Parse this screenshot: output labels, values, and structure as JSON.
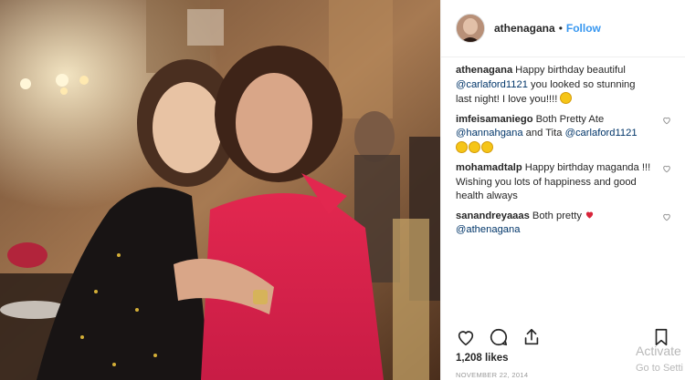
{
  "post": {
    "username": "athenagana",
    "separator": "•",
    "follow_label": "Follow",
    "likes": "1,208 likes",
    "date": "NOVEMBER 22, 2014"
  },
  "comments": [
    {
      "user": "athenagana",
      "parts": [
        "Happy birthday beautiful ",
        "@carlaford1121",
        " you looked so stunning last night! I love you!!!! "
      ],
      "emoji": "smiling-face",
      "liked": false,
      "has_heart": false
    },
    {
      "user": "imfeisamaniego",
      "parts": [
        "Both Pretty Ate ",
        "@hannahgana",
        " and Tita ",
        "@carlaford1121"
      ],
      "emoji_count": 3,
      "has_heart": true
    },
    {
      "user": "mohamadtalp",
      "text": "Happy birthday maganda !!! Wishing you lots of happiness and good health always",
      "has_heart": true
    },
    {
      "user": "sanandreyaaas",
      "parts": [
        "Both pretty ",
        "@athenagana"
      ],
      "red_heart": true,
      "has_heart": true
    }
  ],
  "icons": {
    "like": "heart-icon",
    "comment": "comment-icon",
    "share": "share-icon",
    "save": "bookmark-icon"
  },
  "watermark": {
    "line1": "Activate",
    "line2": "Go to Setti"
  },
  "colors": {
    "link": "#003569",
    "follow": "#3897f0",
    "text": "#262626"
  }
}
